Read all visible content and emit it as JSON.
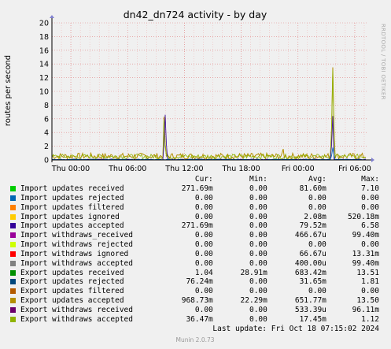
{
  "chart_data": {
    "type": "line",
    "title": "dn42_dn724 activity - by day",
    "ylabel": "routes per second",
    "ylim": [
      0,
      20
    ],
    "yticks": [
      0,
      2,
      4,
      6,
      8,
      10,
      12,
      14,
      16,
      18,
      20
    ],
    "xticks": [
      "Thu 00:00",
      "Thu 06:00",
      "Thu 12:00",
      "Thu 18:00",
      "Fri 00:00",
      "Fri 06:00"
    ],
    "grid": true,
    "spikes": [
      {
        "x": "Thu 12:00",
        "value": 6.6,
        "series": "Import updates accepted"
      },
      {
        "x": "Fri 04:00",
        "value": 13.5,
        "series": "Export updates accepted"
      }
    ]
  },
  "side_text": "RRDTOOL / TOBI OETIKER",
  "legend": {
    "headers": {
      "cur": "Cur:",
      "min": "Min:",
      "avg": "Avg:",
      "max": "Max:"
    },
    "rows": [
      {
        "name": "Import updates received",
        "color": "#00cc00",
        "cur": "271.69m",
        "min": "0.00",
        "avg": "81.60m",
        "max": "7.10"
      },
      {
        "name": "Import updates rejected",
        "color": "#0066b3",
        "cur": "0.00",
        "min": "0.00",
        "avg": "0.00",
        "max": "0.00"
      },
      {
        "name": "Import updates filtered",
        "color": "#ff8000",
        "cur": "0.00",
        "min": "0.00",
        "avg": "0.00",
        "max": "0.00"
      },
      {
        "name": "Import updates ignored",
        "color": "#ffcc00",
        "cur": "0.00",
        "min": "0.00",
        "avg": "2.08m",
        "max": "520.18m"
      },
      {
        "name": "Import updates accepted",
        "color": "#330099",
        "cur": "271.69m",
        "min": "0.00",
        "avg": "79.52m",
        "max": "6.58"
      },
      {
        "name": "Import withdraws_received",
        "color": "#990099",
        "cur": "0.00",
        "min": "0.00",
        "avg": "466.67u",
        "max": "99.40m"
      },
      {
        "name": "Import withdraws rejected",
        "color": "#ccff00",
        "cur": "0.00",
        "min": "0.00",
        "avg": "0.00",
        "max": "0.00"
      },
      {
        "name": "Import withdraws ignored",
        "color": "#ff0000",
        "cur": "0.00",
        "min": "0.00",
        "avg": "66.67u",
        "max": "13.31m"
      },
      {
        "name": "Import withdraws accepted",
        "color": "#808080",
        "cur": "0.00",
        "min": "0.00",
        "avg": "400.00u",
        "max": "99.40m"
      },
      {
        "name": "Export updates received",
        "color": "#008f00",
        "cur": "1.04",
        "min": "28.91m",
        "avg": "683.42m",
        "max": "13.51"
      },
      {
        "name": "Export updates rejected",
        "color": "#00487d",
        "cur": "76.24m",
        "min": "0.00",
        "avg": "31.65m",
        "max": "1.81"
      },
      {
        "name": "Export updates filtered",
        "color": "#b35a00",
        "cur": "0.00",
        "min": "0.00",
        "avg": "0.00",
        "max": "0.00"
      },
      {
        "name": "Export updates accepted",
        "color": "#b38f00",
        "cur": "968.73m",
        "min": "22.29m",
        "avg": "651.77m",
        "max": "13.50"
      },
      {
        "name": "Export withdraws received",
        "color": "#6b006b",
        "cur": "0.00",
        "min": "0.00",
        "avg": "533.39u",
        "max": "96.11m"
      },
      {
        "name": "Export withdraws accepted",
        "color": "#8fb300",
        "cur": "36.47m",
        "min": "0.00",
        "avg": "17.45m",
        "max": "1.12"
      }
    ]
  },
  "last_update": "Last update: Fri Oct 18 07:15:02 2024",
  "footer": "Munin 2.0.73"
}
